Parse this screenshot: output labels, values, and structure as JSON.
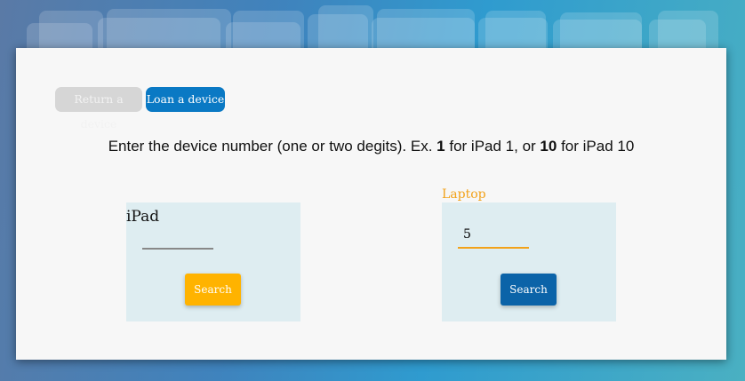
{
  "tabs": {
    "return_label": "Return a device",
    "loan_label": "Loan a device"
  },
  "instructions": {
    "prefix": "Enter the device number (one or two degits). Ex. ",
    "example1": "1",
    "middle": " for iPad 1, or ",
    "example2": "10",
    "suffix": " for iPad 10"
  },
  "ipad_panel": {
    "label": "iPad",
    "input_value": "",
    "search_label": "Search"
  },
  "laptop_panel": {
    "label": "Laptop",
    "input_value": "5",
    "search_label": "Search"
  },
  "colors": {
    "active_tab": "#0a79c4",
    "inactive_tab": "#d6d6d6",
    "amber_button": "#ffb300",
    "blue_button": "#0b63a8",
    "laptop_label": "#f2a21a",
    "panel_bg": "#deedf1"
  }
}
